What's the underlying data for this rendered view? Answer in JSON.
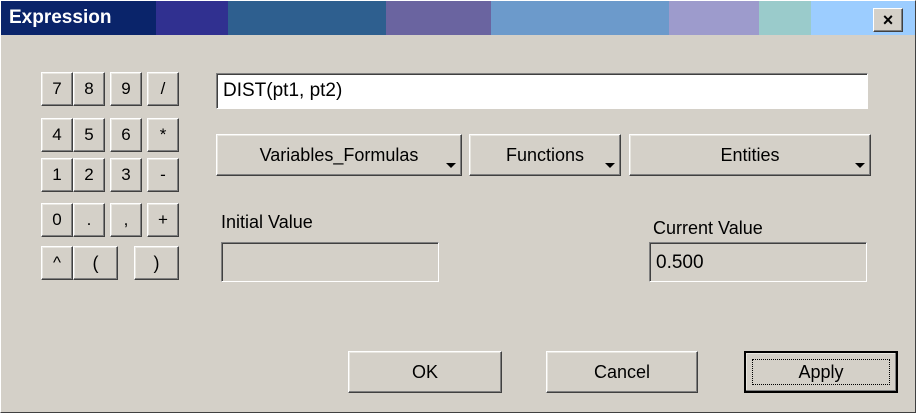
{
  "window": {
    "title": "Expression",
    "close_label": "×",
    "titlebar_colors": [
      "#0a246a",
      "#303090",
      "#2e5f8f",
      "#6a64a0",
      "#6c9acb",
      "#9d9bcc",
      "#9acbcb",
      "#9ccdff"
    ]
  },
  "keypad": {
    "rows": [
      [
        "7",
        "8",
        "9",
        "/"
      ],
      [
        "4",
        "5",
        "6",
        "*"
      ],
      [
        "1",
        "2",
        "3",
        "-"
      ],
      [
        "0",
        ".",
        ",",
        "+"
      ],
      [
        "^",
        "(",
        ")"
      ]
    ]
  },
  "expression": {
    "value": "DIST(pt1, pt2)"
  },
  "menus": {
    "variables_label": "Variables_Formulas",
    "functions_label": "Functions",
    "entities_label": "Entities"
  },
  "initial_value": {
    "label": "Initial Value",
    "value": ""
  },
  "current_value": {
    "label": "Current Value",
    "value": "0.500"
  },
  "buttons": {
    "ok": "OK",
    "cancel": "Cancel",
    "apply": "Apply"
  }
}
